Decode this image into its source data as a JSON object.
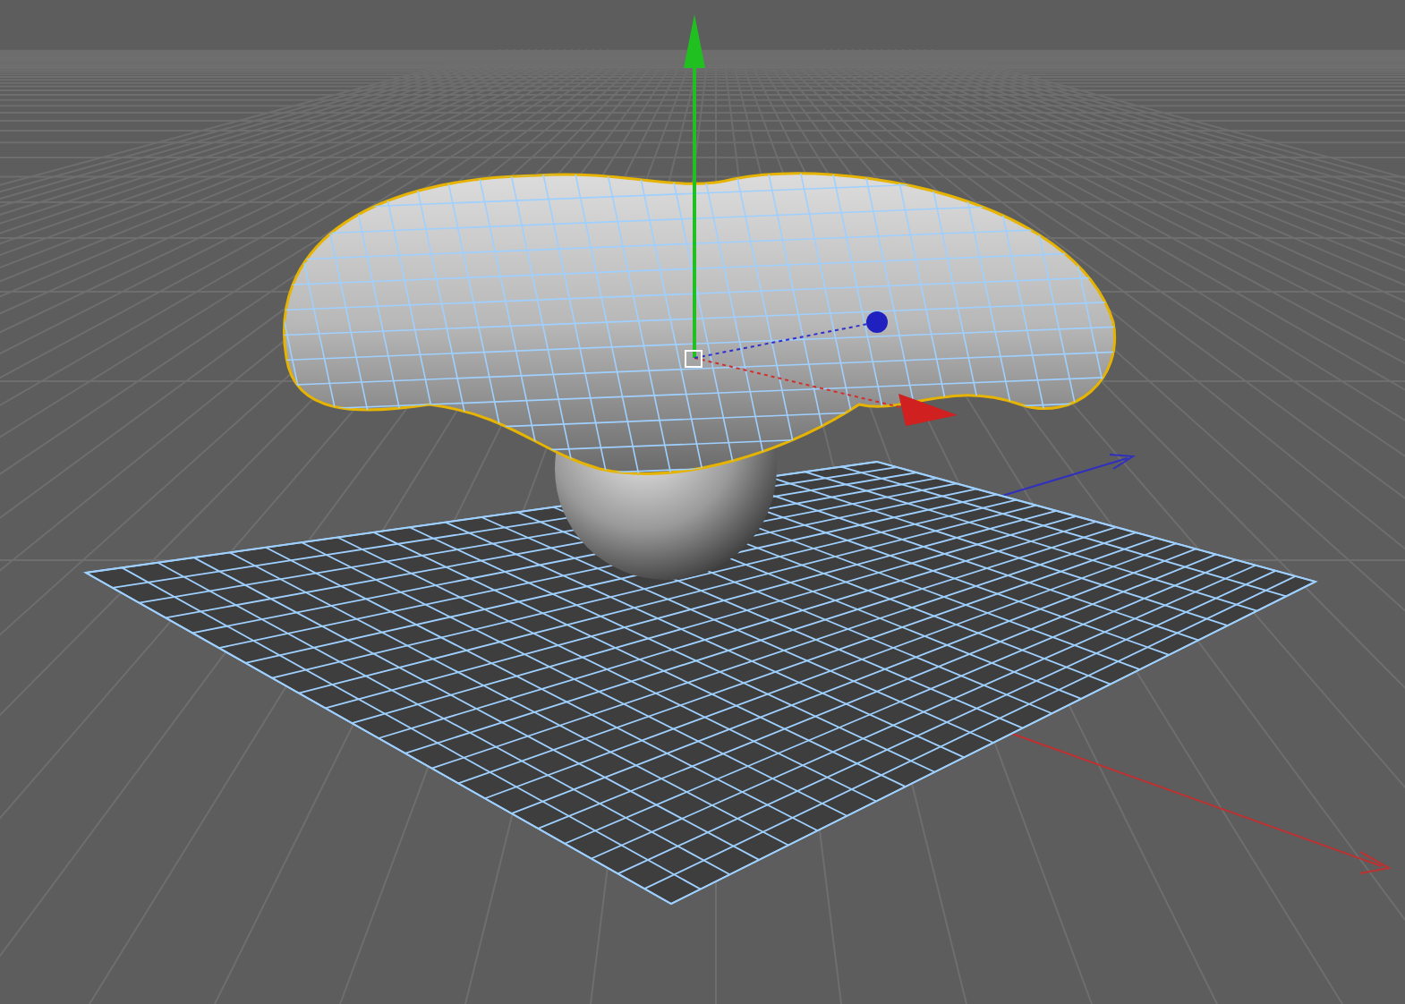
{
  "viewport": {
    "objects": [
      {
        "kind": "plane",
        "selected": true
      },
      {
        "kind": "sphere",
        "selected": false
      },
      {
        "kind": "cloth",
        "selected": true
      }
    ]
  }
}
